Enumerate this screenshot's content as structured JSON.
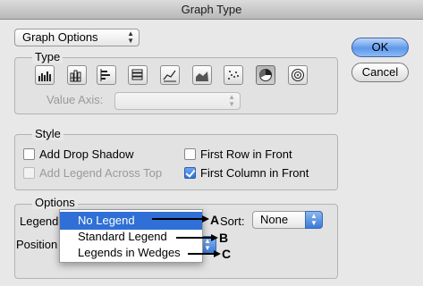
{
  "window": {
    "title": "Graph Type"
  },
  "panel_select": {
    "value": "Graph Options"
  },
  "type_group": {
    "title": "Type",
    "graph_types": [
      {
        "name": "column-graph"
      },
      {
        "name": "stacked-column-graph"
      },
      {
        "name": "bar-graph"
      },
      {
        "name": "stacked-bar-graph"
      },
      {
        "name": "line-graph"
      },
      {
        "name": "area-graph"
      },
      {
        "name": "scatter-graph"
      },
      {
        "name": "pie-graph",
        "selected": true
      },
      {
        "name": "radar-graph"
      }
    ],
    "value_axis_label": "Value Axis:",
    "value_axis_value": ""
  },
  "style_group": {
    "title": "Style",
    "add_drop_shadow": {
      "label": "Add Drop Shadow",
      "checked": false
    },
    "first_row_in_front": {
      "label": "First Row in Front",
      "checked": false
    },
    "add_legend_across_top": {
      "label": "Add Legend Across Top",
      "checked": false,
      "disabled": true
    },
    "first_column_in_front": {
      "label": "First Column in Front",
      "checked": true
    }
  },
  "options_group": {
    "title": "Options",
    "legend_label": "Legend",
    "position_label": "Position",
    "sort_label": "Sort:",
    "sort_value": "None",
    "legend_menu": [
      "No Legend",
      "Standard Legend",
      "Legends in Wedges"
    ],
    "legend_selected_index": 0
  },
  "buttons": {
    "ok": "OK",
    "cancel": "Cancel"
  },
  "callouts": [
    "A",
    "B",
    "C"
  ],
  "colors": {
    "accent": "#2f6fd6",
    "default_button": "#5d98ea"
  }
}
